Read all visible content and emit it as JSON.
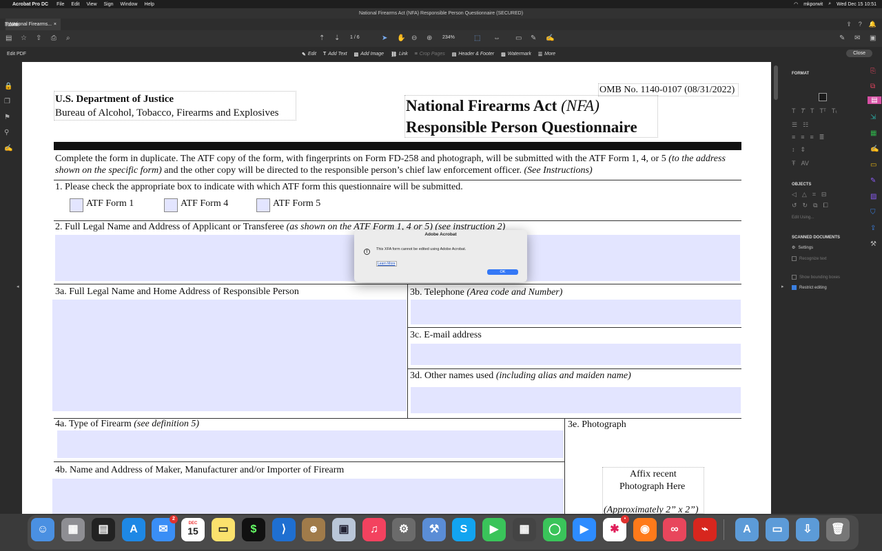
{
  "menubar": {
    "app_name": "Acrobat Pro DC",
    "items": [
      "File",
      "Edit",
      "View",
      "Sign",
      "Window",
      "Help"
    ],
    "user": "mkporwit",
    "clock": "Wed Dec 15  10:51"
  },
  "window_title": "National Firearms Act (NFA) Responsible Person Questionnaire (SECURED)",
  "tabs": {
    "home": "Home",
    "tools": "Tools",
    "doc": "National Firearms...",
    "doc_close": "×"
  },
  "toolbar": {
    "page_current": "1",
    "page_sep": "/",
    "page_total": "6",
    "zoom": "234%"
  },
  "editbar": {
    "label": "Edit PDF",
    "tools": [
      "Edit",
      "Add Text",
      "Add Image",
      "Link",
      "Crop Pages",
      "Header & Footer",
      "Watermark",
      "More"
    ],
    "close": "Close"
  },
  "form": {
    "omb": "OMB No. 1140-0107 (08/31/2022)",
    "dept": "U.S. Department of Justice",
    "bureau": "Bureau of Alcohol, Tobacco, Firearms and Explosives",
    "title_1": "National Firearms Act",
    "title_nfa": "(NFA)",
    "title_2": "Responsible Person Questionnaire",
    "instr_1": "Complete the form in duplicate.  The ATF copy of the form, with fingerprints on Form FD-258 and photograph, will be submitted with the ATF Form 1, 4, or 5",
    "instr_1b": "(to the address",
    "instr_2a": "shown on the specific form)",
    "instr_2b": "and the other copy will be directed to the responsible person’s chief law enforcement officer.",
    "instr_2c": "(See Instructions)",
    "q1": "1.  Please check the appropriate box to indicate with which ATF form this questionnaire will be submitted.",
    "cb1": "ATF Form 1",
    "cb4": "ATF Form 4",
    "cb5": "ATF Form 5",
    "q2": "2.  Full Legal Name and Address of Applicant or Transferee",
    "q2i": "(as shown on the ATF Form 1, 4 or 5) (see instruction 2)",
    "q3a": "3a.  Full Legal Name and Home Address of Responsible Person",
    "q3b": "3b.  Telephone",
    "q3bi": "(Area code and Number)",
    "q3c": "3c.  E-mail address",
    "q3d": "3d.  Other names used",
    "q3di": "(including alias and maiden name)",
    "q4a": "4a.  Type of Firearm",
    "q4ai": "(see definition 5)",
    "q3e": "3e.  Photograph",
    "q4b": "4b.  Name and Address of Maker, Manufacturer and/or Importer of Firearm",
    "photo_1": "Affix recent",
    "photo_2": "Photograph Here",
    "photo_3": "(Approximately 2” x 2”)"
  },
  "dialog": {
    "title": "Adobe Acrobat",
    "message": "This XFA form cannot be edited using Adobe Acrobat.",
    "learn_more": "Learn More",
    "ok": "OK"
  },
  "rightpanel": {
    "format": "FORMAT",
    "objects": "OBJECTS",
    "edit_using": "Edit Using...",
    "scanned": "SCANNED DOCUMENTS",
    "settings": "Settings",
    "recognize": "Recognize text",
    "bounding": "Show bounding boxes",
    "restrict": "Restrict editing"
  },
  "dock": {
    "calendar_month": "DEC",
    "calendar_day": "15",
    "mail_badge": "2",
    "slack_badge": "•"
  }
}
